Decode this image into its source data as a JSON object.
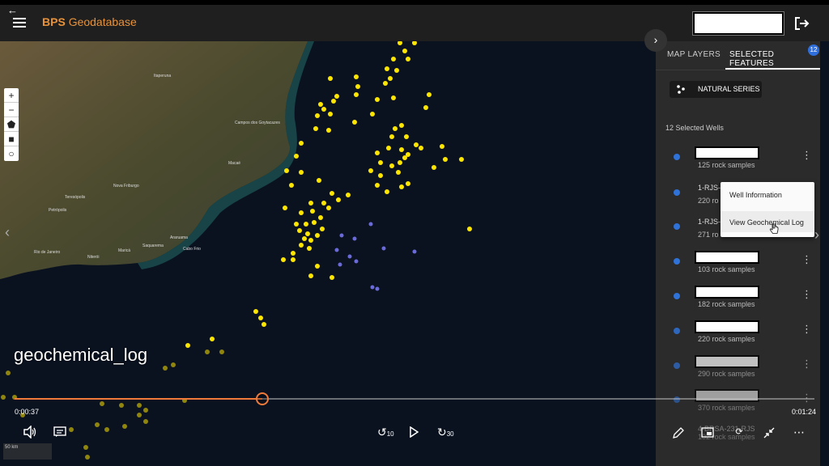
{
  "app": {
    "brand": "BPS",
    "title": "Geodatabase"
  },
  "map_labels": [
    "Rio de Janeiro",
    "Niterói",
    "Petrópolis",
    "Teresópolis",
    "Nova Friburgo",
    "Cabo Frio",
    "Macaé",
    "Campos dos Goytacazes",
    "Itaperuna",
    "Araruama",
    "Saquarema",
    "Maricá"
  ],
  "map_controls": {
    "zoom_in": "+",
    "zoom_out": "−"
  },
  "panel": {
    "toggle": "›",
    "tabs": [
      {
        "label": "MAP LAYERS"
      },
      {
        "label": "SELECTED FEATURES"
      }
    ],
    "badge": "12",
    "series_button": "NATURAL SERIES",
    "wells_count": "12 Selected Wells",
    "wells": [
      {
        "name": "",
        "samples": "125 rock samples"
      },
      {
        "name": "1-RJS-",
        "samples": "220 ro"
      },
      {
        "name": "1-RJS-",
        "samples": "271 ro"
      },
      {
        "name": "",
        "samples": "103 rock samples"
      },
      {
        "name": "",
        "samples": "182 rock samples"
      },
      {
        "name": "",
        "samples": "220 rock samples"
      },
      {
        "name": "",
        "samples": "290 rock samples"
      },
      {
        "name": "",
        "samples": "370 rock samples"
      },
      {
        "name": "4-BRSA-231-RJS",
        "samples": "102 rock samples"
      }
    ]
  },
  "context_menu": {
    "items": [
      "Well Information",
      "View Geochemical Log"
    ]
  },
  "video": {
    "caption": "geochemical_log",
    "current_time": "0:00:37",
    "total_time": "0:01:24",
    "progress": 0.31,
    "rewind_label": "10",
    "forward_label": "30",
    "scale_label": "50 km"
  },
  "colors": {
    "accent": "#e8923a",
    "well_dot": "#2f72d8",
    "sample_yellow": "#ffe600",
    "sample_purple": "#6a6ad8",
    "progress": "#f07a3a"
  }
}
